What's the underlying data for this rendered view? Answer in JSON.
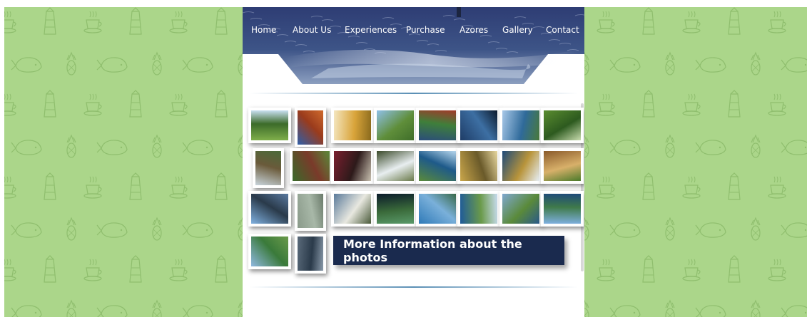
{
  "nav": {
    "items": [
      {
        "label": "Home"
      },
      {
        "label": "About Us"
      },
      {
        "label": "Experiences"
      },
      {
        "label": "Purchase"
      },
      {
        "label": "Azores"
      },
      {
        "label": "Gallery"
      },
      {
        "label": "Contact"
      }
    ]
  },
  "gallery": {
    "photos": [
      {
        "subject": "green lagoon landscape"
      },
      {
        "subject": "red earth field"
      },
      {
        "subject": "pineapples"
      },
      {
        "subject": "green pastures"
      },
      {
        "subject": "red and green hills"
      },
      {
        "subject": "whale tail in ocean"
      },
      {
        "subject": "coastal cliffs"
      },
      {
        "subject": "forest path"
      },
      {
        "subject": "wooden walkway"
      },
      {
        "subject": "tea plantation rows"
      },
      {
        "subject": "wine bottles"
      },
      {
        "subject": "volcanic steam"
      },
      {
        "subject": "crater lakes"
      },
      {
        "subject": "cheese cellar"
      },
      {
        "subject": "aerial island view"
      },
      {
        "subject": "food platter"
      },
      {
        "subject": "Pico mountain"
      },
      {
        "subject": "lava stone"
      },
      {
        "subject": "white buildings"
      },
      {
        "subject": "cave opening"
      },
      {
        "subject": "blue bay"
      },
      {
        "subject": "coastline peninsula"
      },
      {
        "subject": "green headland"
      },
      {
        "subject": "sea cliffs"
      },
      {
        "subject": "lake valley"
      },
      {
        "subject": "lava rock shore"
      }
    ],
    "info_button": "More Information about the photos"
  },
  "colors": {
    "side_background": "#abd68a",
    "pattern_line": "#8fbe6e",
    "header_sea": "#2c3e72",
    "button_bg": "#1a2a4e"
  }
}
